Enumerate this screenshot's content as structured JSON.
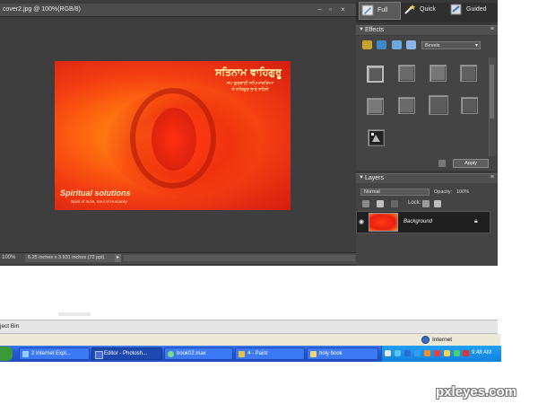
{
  "document": {
    "title": "cover2.jpg @ 100%(RGB/8)",
    "zoom": "100%",
    "doc_size": "6.25 inches x 3.931 inches (72 ppi)"
  },
  "artwork": {
    "headline": "ਸਤਿਨਾਮ ਵਾਹਿਗੁਰੂ",
    "subline_1": "ਜਪ ਗੁਰਬਾਣੀ ਜਪਿਆਕਰਿਆ",
    "subline_2": "ਜੇ ਸਤਿਗੁਰ ਭਾਵੇ ਸਹਿਜੇ",
    "brand": "Spiritual solutions",
    "tagline": "Spirit of India, Soul of Humanity"
  },
  "modes": [
    {
      "label": "Full",
      "icon": "pencil-icon"
    },
    {
      "label": "Quick",
      "icon": "wand-icon"
    },
    {
      "label": "Guided",
      "icon": "guided-icon"
    }
  ],
  "effects": {
    "header": "Effects",
    "dropdown_value": "Bevels",
    "apply_label": "Apply"
  },
  "layers": {
    "header": "Layers",
    "blend_mode": "Normal",
    "opacity_label": "Opacity:",
    "opacity_value": "100%",
    "lock_label": "Lock:",
    "layer_name": "Background"
  },
  "project_bin": {
    "label": "ject Bin"
  },
  "ie_status": {
    "zone": "Internet"
  },
  "taskbar": {
    "buttons": [
      {
        "label": "2 Internet Expl...",
        "active": false
      },
      {
        "label": "Editor - Photosh...",
        "active": true
      },
      {
        "label": "book02.max",
        "active": false
      },
      {
        "label": "4 - Paint",
        "active": false
      },
      {
        "label": "holy book",
        "active": false
      }
    ],
    "clock": "9:48 AM"
  },
  "watermark": "pxleyes.com",
  "colors": {
    "panel_bg": "#3a3a3a",
    "taskbar_blue": "#2458d4",
    "tray_blue": "#0f82dc"
  }
}
